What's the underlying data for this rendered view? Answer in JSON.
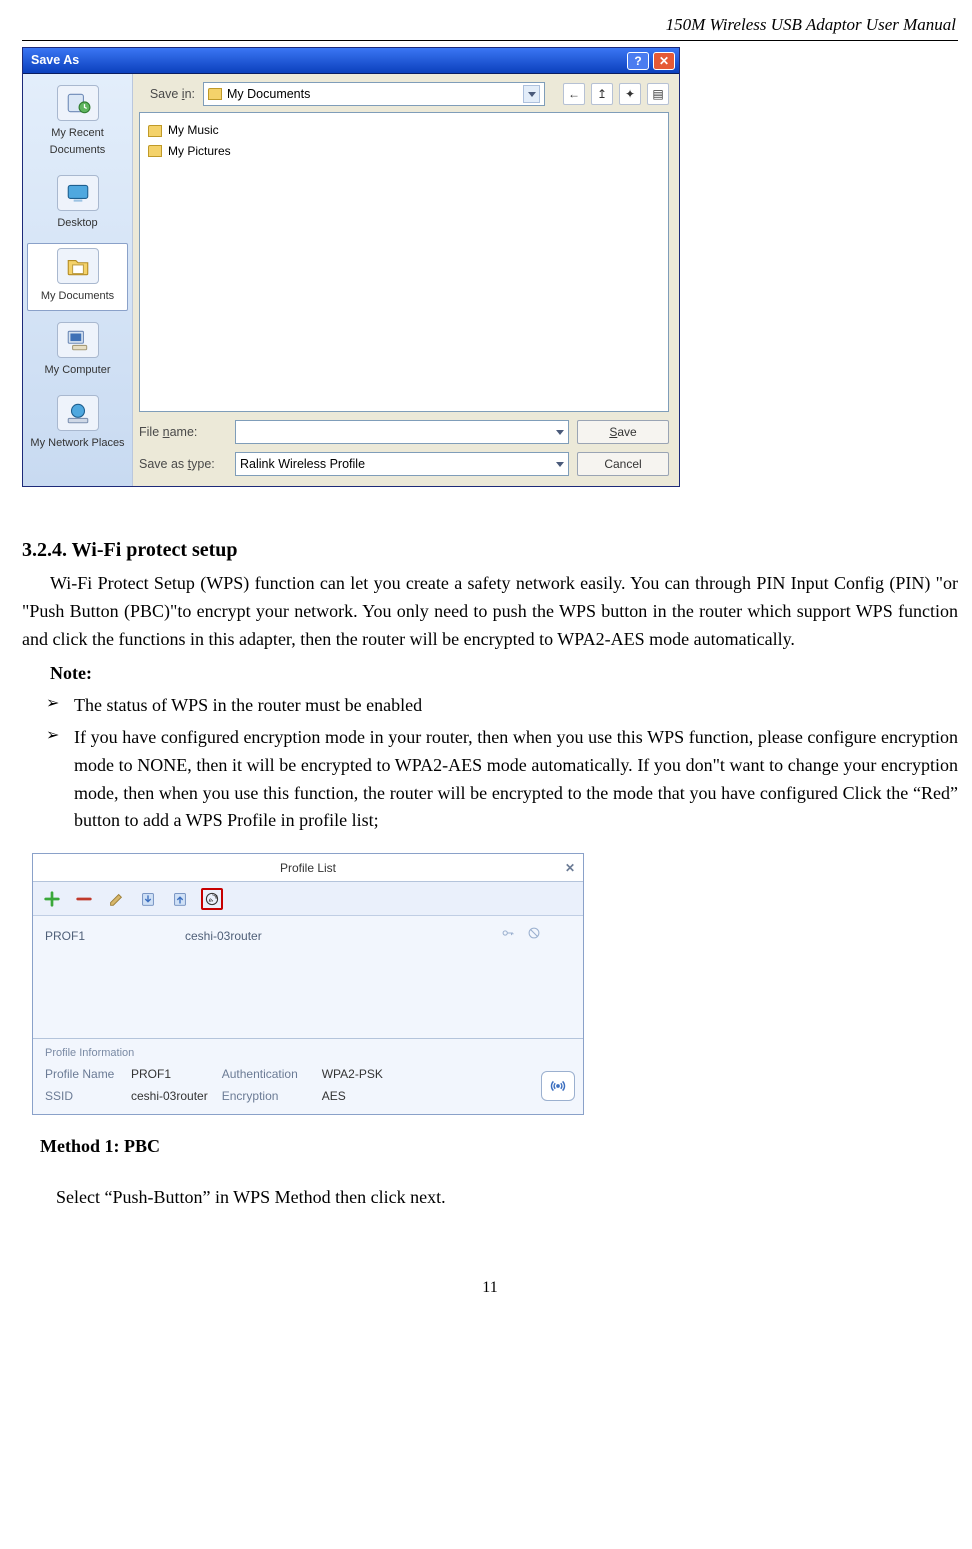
{
  "doc_header": "150M Wireless USB Adaptor User Manual",
  "page_number": "11",
  "saveas": {
    "title": "Save As",
    "help_glyph": "?",
    "close_glyph": "✕",
    "savein_label": "Save in:",
    "savein_value": "My Documents",
    "nav_icons": [
      "←",
      "↥",
      "✦",
      "▤",
      "▾"
    ],
    "items": [
      "My Music",
      "My Pictures"
    ],
    "filename_label": "File name:",
    "filename_value": "",
    "savetype_label": "Save as type:",
    "savetype_value": "Ralink Wireless Profile",
    "save_btn": "Save",
    "cancel_btn": "Cancel",
    "places": [
      {
        "label": "My Recent Documents",
        "active": false
      },
      {
        "label": "Desktop",
        "active": false
      },
      {
        "label": "My Documents",
        "active": true
      },
      {
        "label": "My Computer",
        "active": false
      },
      {
        "label": "My Network Places",
        "active": false
      }
    ]
  },
  "section_heading": "3.2.4. Wi-Fi protect setup",
  "paragraph": "Wi-Fi Protect Setup (WPS) function can let you create a safety network easily. You can through PIN Input Config (PIN) \"or \"Push Button (PBC)\"to encrypt your network. You only need    to    push    the    WPS button    in    the    router    which    support    WPS function    and    click    the functions in this adapter, then the router will be encrypted to WPA2-AES mode automatically.",
  "note_label": "Note:",
  "bullets": [
    "The status of WPS in the router must be enabled",
    "If you have configured encryption mode in your router, then when you use this WPS function,    please configure    encryption    mode    to    NONE,    then    it    will be    encrypted    to WPA2-AES mode automatically. If you don\"t want to change your encryption mode, then when you use    this    function, the    router    will be    encrypted    to the    mode    that you have configured Click the “Red” button to add a WPS Profile in profile list;"
  ],
  "panel": {
    "title": "Profile List",
    "close_glyph": "✕",
    "row": {
      "name": "PROF1",
      "ssid": "ceshi-03router"
    },
    "info_legend": "Profile Information",
    "kv": {
      "profile_name_k": "Profile Name",
      "profile_name_v": "PROF1",
      "ssid_k": "SSID",
      "ssid_v": "ceshi-03router",
      "auth_k": "Authentication",
      "auth_v": "WPA2-PSK",
      "enc_k": "Encryption",
      "enc_v": "AES"
    }
  },
  "method_heading": "Method 1: PBC",
  "step_text": "Select “Push-Button” in WPS Method then click next."
}
